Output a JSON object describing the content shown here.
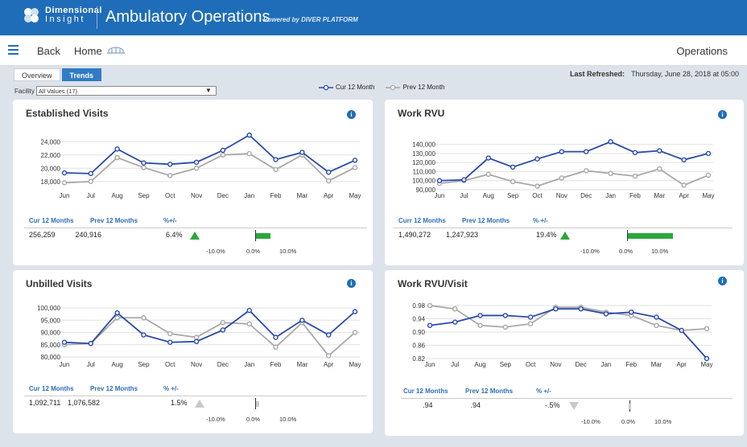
{
  "header": {
    "logo_line1": "Dimensional",
    "logo_line2": "Insight",
    "app_title": "Ambulatory Operations",
    "powered_by": "Powered by DIVER PLATFORM"
  },
  "nav": {
    "back": "Back",
    "home": "Home",
    "right_title": "Operations"
  },
  "tabs": [
    {
      "label": "Overview",
      "active": false
    },
    {
      "label": "Trends",
      "active": true
    }
  ],
  "refreshed": {
    "label": "Last Refreshed:",
    "value": "Thursday, June 28, 2018 at 05:00"
  },
  "facility": {
    "label": "Facility",
    "value": "All Values (17)"
  },
  "legend": {
    "current": "Cur 12 Month",
    "previous": "Prev 12 Month"
  },
  "colors": {
    "current": "#2a4aa8",
    "previous": "#a8a8a8",
    "positive": "#2aa83b",
    "neutral": "#c8c8c8",
    "brand": "#1f6db8"
  },
  "panels": [
    {
      "title": "Established Visits",
      "summary": {
        "h_cur": "Cur 12 Months",
        "h_prev": "Prev 12 Months",
        "h_pct": "%+/-",
        "cur": "256,259",
        "prev": "240,916",
        "pct": "6.4%",
        "direction": "up",
        "pct_value": 6.4,
        "scale": [
          "-10.0%",
          "0.0%",
          "10.0%"
        ]
      },
      "chart_data": {
        "type": "line",
        "categories": [
          "Jun",
          "Jul",
          "Aug",
          "Sep",
          "Oct",
          "Nov",
          "Dec",
          "Jan",
          "Feb",
          "Mar",
          "Apr",
          "May"
        ],
        "yticks": [
          "24,000",
          "22,000",
          "20,000",
          "18,000"
        ],
        "ylim": [
          17000,
          25000
        ],
        "series": [
          {
            "name": "Cur 12 Month",
            "values": [
              19300,
              19200,
              22900,
              20800,
              20600,
              20900,
              22700,
              25000,
              21300,
              22400,
              19400,
              21200
            ]
          },
          {
            "name": "Prev 12 Month",
            "values": [
              17800,
              18000,
              21600,
              20100,
              18900,
              20000,
              22000,
              22200,
              19800,
              22000,
              18100,
              20100
            ]
          }
        ]
      }
    },
    {
      "title": "Work RVU",
      "summary": {
        "h_cur": "Curr 12 Months",
        "h_prev": "Prev 12 Months",
        "h_pct": "% +/-",
        "cur": "1,490,272",
        "prev": "1,247,923",
        "pct": "19.4%",
        "direction": "up",
        "pct_value": 19.4,
        "scale": [
          "-10.0%",
          "0.0%",
          "10.0%"
        ]
      },
      "chart_data": {
        "type": "line",
        "categories": [
          "Jun",
          "Jul",
          "Aug",
          "Sep",
          "Oct",
          "Nov",
          "Dec",
          "Jan",
          "Feb",
          "Mar",
          "Apr",
          "May"
        ],
        "yticks": [
          "140,000",
          "130,000",
          "120,000",
          "110,000",
          "100,000",
          "90,000"
        ],
        "ylim": [
          90000,
          145000
        ],
        "series": [
          {
            "name": "Cur 12 Month",
            "values": [
              100000,
              101000,
              125000,
              115000,
              124000,
              132000,
              132000,
              143000,
              131000,
              133000,
              123000,
              130000
            ]
          },
          {
            "name": "Prev 12 Month",
            "values": [
              97000,
              100000,
              107000,
              99000,
              94000,
              103000,
              111000,
              108000,
              105000,
              113000,
              95000,
              106000
            ]
          }
        ]
      }
    },
    {
      "title": "Unbilled Visits",
      "summary": {
        "h_cur": "Cur 12 Months",
        "h_prev": "Prev 12 Months",
        "h_pct": "% +/-",
        "cur": "1,092,711",
        "prev": "1,076,582",
        "pct": "1.5%",
        "direction": "neutral",
        "pct_value": 1.5,
        "scale": [
          "-10.0%",
          "0.0%",
          "10.0%"
        ]
      },
      "chart_data": {
        "type": "line",
        "categories": [
          "Jun",
          "Jul",
          "Aug",
          "Sep",
          "Oct",
          "Nov",
          "Dec",
          "Jan",
          "Feb",
          "Mar",
          "Apr",
          "May"
        ],
        "yticks": [
          "100,000",
          "95,000",
          "90,000",
          "85,000",
          "80,000"
        ],
        "ylim": [
          80000,
          101000
        ],
        "series": [
          {
            "name": "Cur 12 Month",
            "values": [
              86000,
              85500,
              98000,
              89000,
              86000,
              86300,
              91000,
              99000,
              88000,
              95000,
              89000,
              98500
            ]
          },
          {
            "name": "Prev 12 Month",
            "values": [
              85000,
              85500,
              96000,
              96000,
              89500,
              88000,
              94000,
              93500,
              84000,
              94000,
              80500,
              90000
            ]
          }
        ]
      }
    },
    {
      "title": "Work RVU/Visit",
      "summary": {
        "h_cur": "Cur 12 Months",
        "h_prev": "Prev 12 Months",
        "h_pct": "% +/-",
        "cur": ".94",
        "prev": ".94",
        "pct": "-.5%",
        "direction": "neutral-down",
        "pct_value": -0.5,
        "scale": [
          "-10.0%",
          "0.0%",
          "10.0%"
        ]
      },
      "chart_data": {
        "type": "line",
        "categories": [
          "Jun",
          "Jul",
          "Aug",
          "Sep",
          "Oct",
          "Nov",
          "Dec",
          "Jan",
          "Feb",
          "Mar",
          "Apr",
          "May"
        ],
        "yticks": [
          "0.98",
          "0.94",
          "0.90",
          "0.86",
          "0.82"
        ],
        "ylim": [
          0.82,
          0.985
        ],
        "series": [
          {
            "name": "Cur 12 Month",
            "values": [
              0.92,
              0.93,
              0.95,
              0.95,
              0.945,
              0.97,
              0.97,
              0.955,
              0.96,
              0.945,
              0.905,
              0.82
            ]
          },
          {
            "name": "Prev 12 Month",
            "values": [
              0.98,
              0.97,
              0.92,
              0.915,
              0.925,
              0.975,
              0.975,
              0.96,
              0.95,
              0.92,
              0.905,
              0.91
            ]
          }
        ]
      }
    }
  ]
}
